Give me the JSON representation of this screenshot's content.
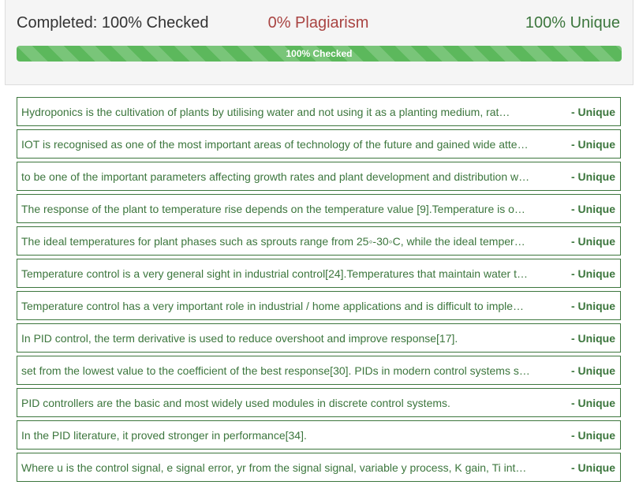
{
  "status": {
    "completed": "Completed: 100% Checked",
    "plagiarism": "0% Plagiarism",
    "unique": "100% Unique"
  },
  "progress": {
    "label": "100% Checked",
    "value": 100
  },
  "results": [
    {
      "text": "Hydroponics is the cultivation of plants by utilising water and not using it as a planting medium, rat…",
      "tag": "- Unique"
    },
    {
      "text": "IOT is recognised as one of the most important areas of technology of the future and gained wide atte…",
      "tag": "- Unique"
    },
    {
      "text": "to be one of the important parameters affecting growth rates and plant development and distribution w…",
      "tag": "- Unique"
    },
    {
      "text": "The response of the plant to temperature rise depends on the temperature value [9].Temperature is o…",
      "tag": "- Unique"
    },
    {
      "text": "The ideal temperatures for plant phases such as sprouts range from 25◦-30◦C, while the ideal temper…",
      "tag": "- Unique"
    },
    {
      "text": "Temperature control is a very general sight in industrial control[24].Temperatures that maintain water t…",
      "tag": "- Unique"
    },
    {
      "text": "Temperature control has a very important role in industrial / home applications and is difficult to imple…",
      "tag": "- Unique"
    },
    {
      "text": "In PID control, the term derivative is used to reduce overshoot and improve response[17].",
      "tag": "- Unique"
    },
    {
      "text": "set from the lowest value to the coefficient of the best response[30]. PIDs in modern control systems s…",
      "tag": "- Unique"
    },
    {
      "text": "PID controllers are the basic and most widely used modules in discrete control systems.",
      "tag": "- Unique"
    },
    {
      "text": "In the PID literature, it proved stronger in performance[34].",
      "tag": "- Unique"
    },
    {
      "text": "Where u is the control signal, e signal error, yr from the signal signal, variable y process, K gain, Ti int…",
      "tag": "- Unique"
    }
  ],
  "colors": {
    "unique_green": "#3c763d",
    "plagiarism_red": "#a94442",
    "progress_green": "#5cb85c"
  }
}
